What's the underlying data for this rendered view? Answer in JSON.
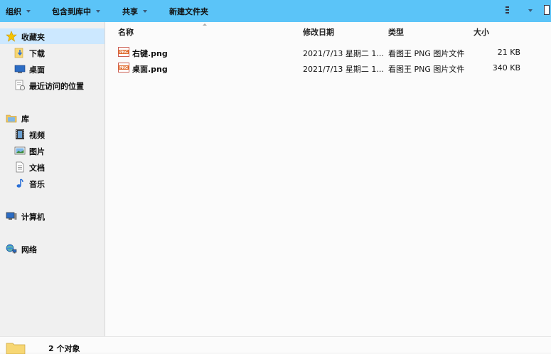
{
  "toolbar": {
    "organize": "组织",
    "include_in_library": "包含到库中",
    "share": "共享",
    "new_folder": "新建文件夹"
  },
  "nav": {
    "favorites": "收藏夹",
    "downloads": "下载",
    "desktop": "桌面",
    "recent_places": "最近访问的位置",
    "libraries": "库",
    "videos": "视频",
    "pictures": "图片",
    "documents": "文档",
    "music": "音乐",
    "computer": "计算机",
    "network": "网络"
  },
  "columns": {
    "name": "名称",
    "date_modified": "修改日期",
    "type": "类型",
    "size": "大小"
  },
  "files": [
    {
      "name": "右键.png",
      "date": "2021/7/13 星期二 1...",
      "type": "看图王 PNG 图片文件",
      "size": "21 KB"
    },
    {
      "name": "桌面.png",
      "date": "2021/7/13 星期二 1...",
      "type": "看图王 PNG 图片文件",
      "size": "340 KB"
    }
  ],
  "status": {
    "count": "2 个对象"
  },
  "colors": {
    "toolbar": "#5bc4f8",
    "selected": "#cce8ff"
  }
}
